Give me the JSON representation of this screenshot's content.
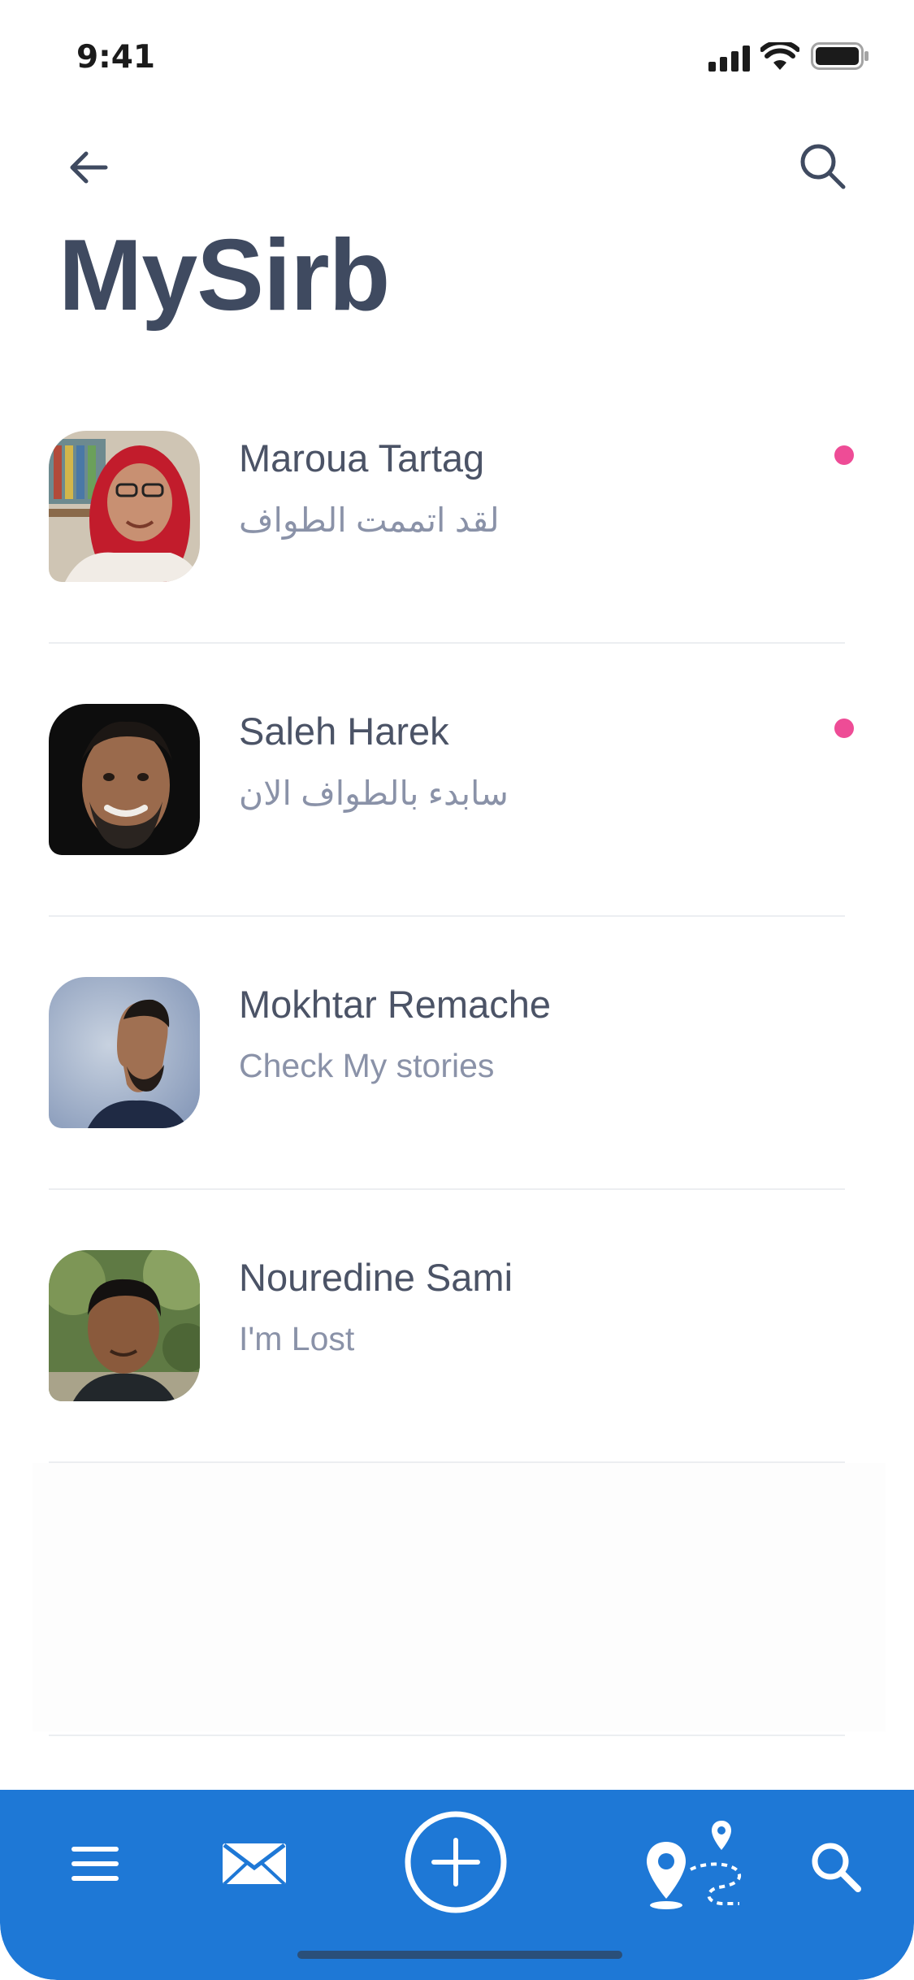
{
  "status_bar": {
    "time": "9:41"
  },
  "header": {
    "title": "MySirb"
  },
  "chats": [
    {
      "name": "Maroua Tartag",
      "message": "لقد اتممت الطواف",
      "unread": true,
      "avatar": "avatar-hijab-woman"
    },
    {
      "name": "Saleh Harek",
      "message": "سابدء بالطواف الان",
      "unread": true,
      "avatar": "avatar-bearded-man"
    },
    {
      "name": "Mokhtar Remache",
      "message": "Check My stories",
      "unread": false,
      "avatar": "avatar-profile-man"
    },
    {
      "name": "Nouredine Sami",
      "message": "I'm Lost",
      "unread": false,
      "avatar": "avatar-young-man"
    }
  ],
  "tabbar": {
    "items": [
      "menu-icon",
      "mail-icon",
      "add-icon",
      "route-map-icon",
      "search-icon"
    ]
  },
  "colors": {
    "title": "#3f4a60",
    "accent": "#1e78d6",
    "unread_dot": "#ee4c96",
    "name_text": "#4b5366",
    "message_text": "#8a92a8"
  }
}
